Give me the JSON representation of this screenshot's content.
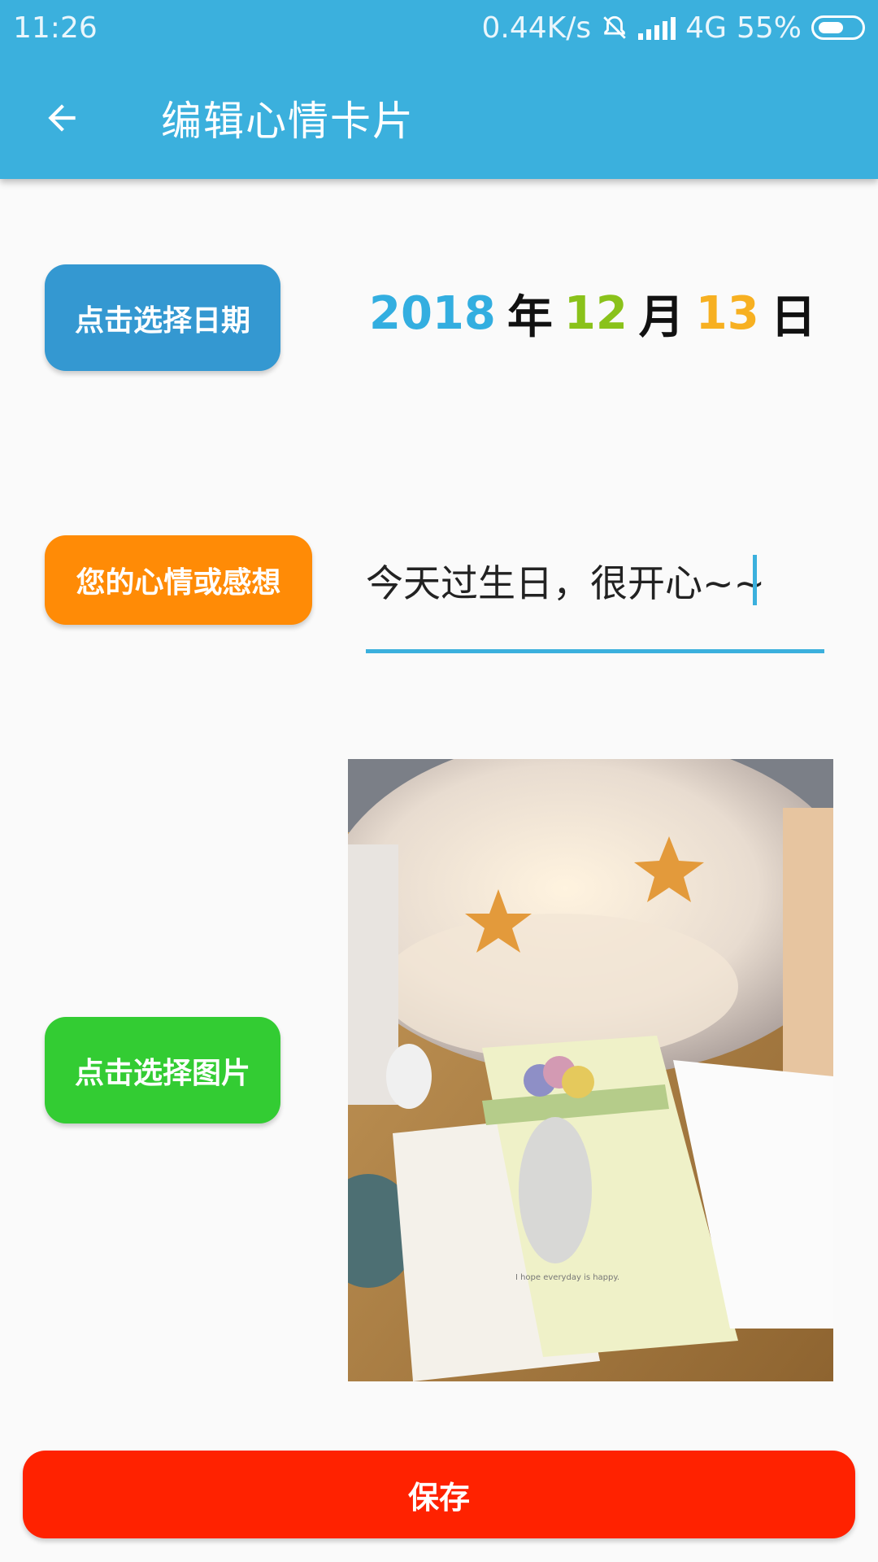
{
  "status_bar": {
    "time": "11:26",
    "net_speed": "0.44K/s",
    "network": "4G",
    "battery": "55%"
  },
  "toolbar": {
    "title": "编辑心情卡片",
    "back_icon": "arrow-left-icon"
  },
  "date_section": {
    "button_label": "点击选择日期",
    "year": "2018",
    "year_unit": "年",
    "month": "12",
    "month_unit": "月",
    "day": "13",
    "day_unit": "日"
  },
  "mood_section": {
    "button_label": "您的心情或感想",
    "input_value": "今天过生日，很开心~~"
  },
  "picture_section": {
    "button_label": "点击选择图片",
    "photo_text": "I hope everyday is happy."
  },
  "save_label": "保存",
  "colors": {
    "appbar": "#3bb0dd",
    "date_button": "#3498d1",
    "mood_button": "#ff8b06",
    "picture_button": "#33cc33",
    "save_button": "#ff2200",
    "year": "#33aee0",
    "month": "#8ac21a",
    "day": "#f7b021"
  }
}
